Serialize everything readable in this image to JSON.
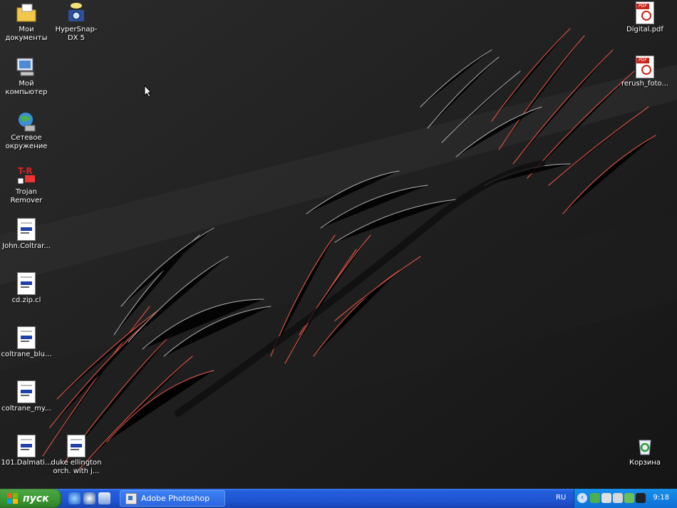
{
  "desktop": {
    "icons_left": [
      {
        "label": "Мои документы",
        "kind": "folder"
      },
      {
        "label": "Мой компьютер",
        "kind": "computer"
      },
      {
        "label": "Сетевое окружение",
        "kind": "network"
      },
      {
        "label": "Trojan Remover",
        "kind": "app"
      },
      {
        "label": "John.Coltrar...",
        "kind": "doc"
      },
      {
        "label": "cd.zip.cl",
        "kind": "doc"
      },
      {
        "label": "coltrane_blu...",
        "kind": "doc"
      },
      {
        "label": "coltrane_my...",
        "kind": "doc"
      },
      {
        "label": "101.Dalmati...",
        "kind": "doc"
      }
    ],
    "hypersnap": {
      "label": "HyperSnap-DX 5"
    },
    "duke": {
      "label": "duke ellington orch. with j..."
    },
    "icons_right": [
      {
        "label": "Digital.pdf"
      },
      {
        "label": "rerush_foto..."
      }
    ],
    "recycle": {
      "label": "Корзина"
    }
  },
  "taskbar": {
    "start_label": "пуск",
    "task_label": "Adobe Photoshop",
    "lang": "RU",
    "clock": "9:18",
    "colors": {
      "start": "#3c9a33",
      "bar": "#245edb",
      "tray": "#1790e8"
    }
  }
}
